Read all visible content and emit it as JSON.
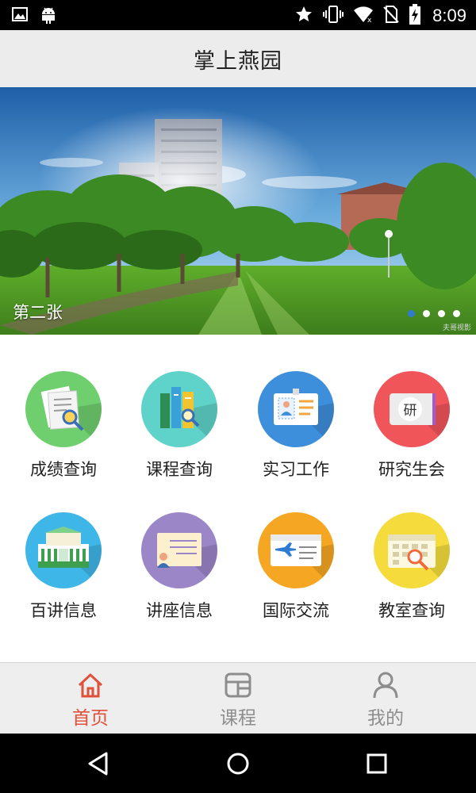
{
  "status_bar": {
    "time": "8:09",
    "left_icons": [
      "image-icon",
      "android-icon"
    ],
    "right_icons": [
      "star-icon",
      "vibrate-icon",
      "wifi-icon",
      "no-sim-icon",
      "battery-icon"
    ]
  },
  "header": {
    "title": "掌上燕园"
  },
  "banner": {
    "caption": "第二张",
    "watermark": "夫哥视影",
    "slide_count": 4,
    "active_index": 0
  },
  "grid": {
    "items": [
      {
        "label": "成绩查询",
        "icon": "grade-report-icon",
        "color": "#6fcf6f"
      },
      {
        "label": "课程查询",
        "icon": "books-icon",
        "color": "#5fd2c9"
      },
      {
        "label": "实习工作",
        "icon": "id-badge-icon",
        "color": "#3d8fdb"
      },
      {
        "label": "研究生会",
        "icon": "graduate-board-icon",
        "color": "#f0555a"
      },
      {
        "label": "百讲信息",
        "icon": "auditorium-icon",
        "color": "#3fb6e8"
      },
      {
        "label": "讲座信息",
        "icon": "lecture-icon",
        "color": "#9b86c8"
      },
      {
        "label": "国际交流",
        "icon": "flight-ticket-icon",
        "color": "#f5a623"
      },
      {
        "label": "教室查询",
        "icon": "calendar-search-icon",
        "color": "#f5dc3c"
      }
    ]
  },
  "tabbar": {
    "tabs": [
      {
        "label": "首页",
        "icon": "home-icon",
        "active": true
      },
      {
        "label": "课程",
        "icon": "course-grid-icon",
        "active": false
      },
      {
        "label": "我的",
        "icon": "person-icon",
        "active": false
      }
    ],
    "active_color": "#e0503a",
    "inactive_color": "#8d8d8d"
  },
  "nav_bar": {
    "buttons": [
      "back-icon",
      "home-circle-icon",
      "recents-icon"
    ]
  }
}
